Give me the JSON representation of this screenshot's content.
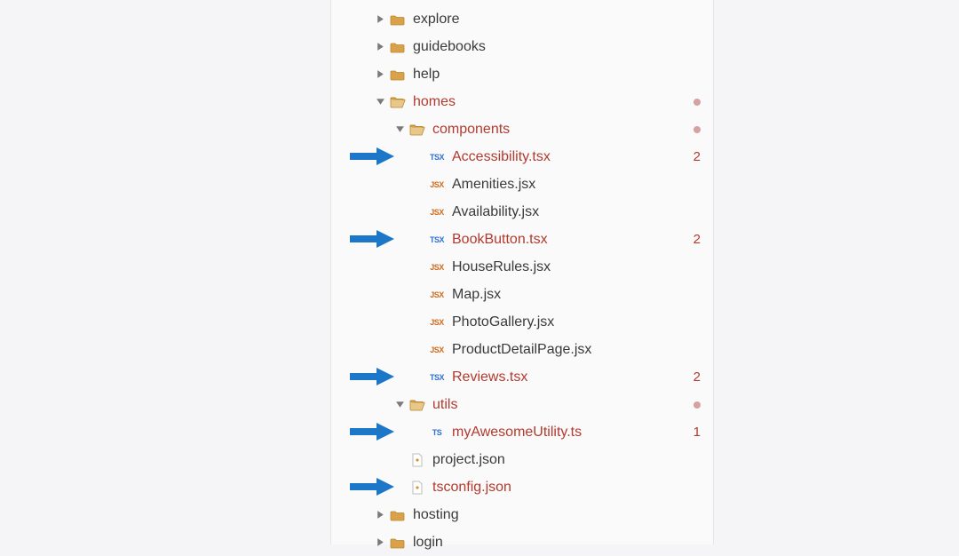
{
  "tree": [
    {
      "depth": 1,
      "kind": "folder",
      "state": "collapsed",
      "label": "explore"
    },
    {
      "depth": 1,
      "kind": "folder",
      "state": "collapsed",
      "label": "guidebooks"
    },
    {
      "depth": 1,
      "kind": "folder",
      "state": "collapsed",
      "label": "help"
    },
    {
      "depth": 1,
      "kind": "folder",
      "state": "expanded-open",
      "label": "homes",
      "modified": true,
      "indicator": "dot"
    },
    {
      "depth": 2,
      "kind": "folder",
      "state": "expanded-open",
      "label": "components",
      "modified": true,
      "indicator": "dot"
    },
    {
      "depth": 3,
      "kind": "file",
      "ext": "TSX",
      "label": "Accessibility.tsx",
      "modified": true,
      "indicator": "2",
      "arrow": true
    },
    {
      "depth": 3,
      "kind": "file",
      "ext": "JSX",
      "label": "Amenities.jsx"
    },
    {
      "depth": 3,
      "kind": "file",
      "ext": "JSX",
      "label": "Availability.jsx"
    },
    {
      "depth": 3,
      "kind": "file",
      "ext": "TSX",
      "label": "BookButton.tsx",
      "modified": true,
      "indicator": "2",
      "arrow": true
    },
    {
      "depth": 3,
      "kind": "file",
      "ext": "JSX",
      "label": "HouseRules.jsx"
    },
    {
      "depth": 3,
      "kind": "file",
      "ext": "JSX",
      "label": "Map.jsx"
    },
    {
      "depth": 3,
      "kind": "file",
      "ext": "JSX",
      "label": "PhotoGallery.jsx"
    },
    {
      "depth": 3,
      "kind": "file",
      "ext": "JSX",
      "label": "ProductDetailPage.jsx"
    },
    {
      "depth": 3,
      "kind": "file",
      "ext": "TSX",
      "label": "Reviews.tsx",
      "modified": true,
      "indicator": "2",
      "arrow": true
    },
    {
      "depth": 2,
      "kind": "folder",
      "state": "expanded-open",
      "label": "utils",
      "modified": true,
      "indicator": "dot"
    },
    {
      "depth": 3,
      "kind": "file",
      "ext": "TS",
      "label": "myAwesomeUtility.ts",
      "modified": true,
      "indicator": "1",
      "arrow": true
    },
    {
      "depth": 2,
      "kind": "file",
      "ext": "JSON",
      "label": "project.json"
    },
    {
      "depth": 2,
      "kind": "file",
      "ext": "JSON",
      "label": "tsconfig.json",
      "modified": true,
      "arrow": true
    },
    {
      "depth": 1,
      "kind": "folder",
      "state": "collapsed",
      "label": "hosting"
    },
    {
      "depth": 1,
      "kind": "folder",
      "state": "collapsed",
      "label": "login"
    }
  ]
}
